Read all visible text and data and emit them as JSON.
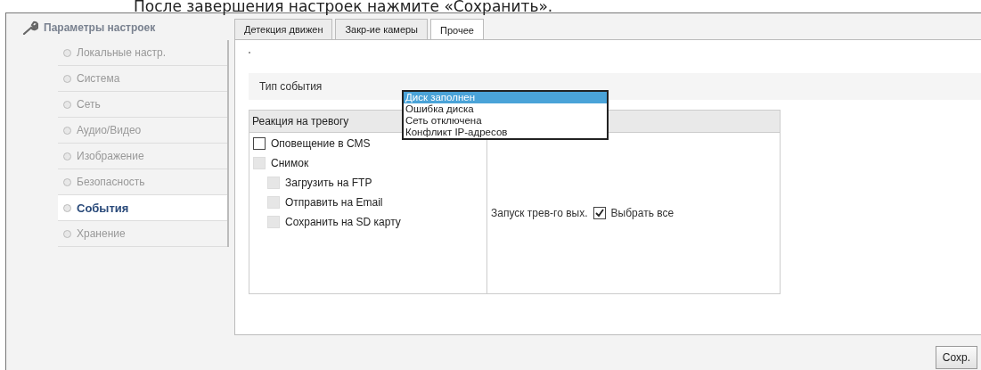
{
  "caption": "После завершения настроек нажмите «Сохранить».",
  "sidebar": {
    "title": "Параметры настроек",
    "items": [
      {
        "label": "Локальные настр.",
        "selected": false
      },
      {
        "label": "Система",
        "selected": false
      },
      {
        "label": "Сеть",
        "selected": false
      },
      {
        "label": "Аудио/Видео",
        "selected": false
      },
      {
        "label": "Изображение",
        "selected": false
      },
      {
        "label": "Безопасность",
        "selected": false
      },
      {
        "label": "События",
        "selected": true
      },
      {
        "label": "Хранение",
        "selected": false
      }
    ]
  },
  "tabs": [
    {
      "label": "Детекция движен",
      "selected": false
    },
    {
      "label": "Закр-ие камеры",
      "selected": false
    },
    {
      "label": "Прочее",
      "selected": true
    }
  ],
  "event_type": {
    "label": "Тип события",
    "options": [
      {
        "label": "Диск заполнен",
        "selected": true
      },
      {
        "label": "Ошибка диска",
        "selected": false
      },
      {
        "label": "Сеть отключена",
        "selected": false
      },
      {
        "label": "Конфликт IP-адресов",
        "selected": false
      }
    ]
  },
  "alarm_reaction": {
    "header": "Реакция на тревогу",
    "options": [
      {
        "label": "Оповещение в CMS",
        "checked": false,
        "disabled": false
      },
      {
        "label": "Снимок",
        "checked": false,
        "disabled": true,
        "children": [
          {
            "label": "Загрузить на FTP",
            "checked": false,
            "disabled": true
          },
          {
            "label": "Отправить на Email",
            "checked": false,
            "disabled": true
          },
          {
            "label": "Сохранить на SD карту",
            "checked": false,
            "disabled": true
          }
        ]
      }
    ],
    "alarm_output": {
      "label": "Запуск трев-го вых.",
      "select_all": {
        "label": "Выбрать все",
        "checked": true
      }
    }
  },
  "save_button": "Сохр."
}
